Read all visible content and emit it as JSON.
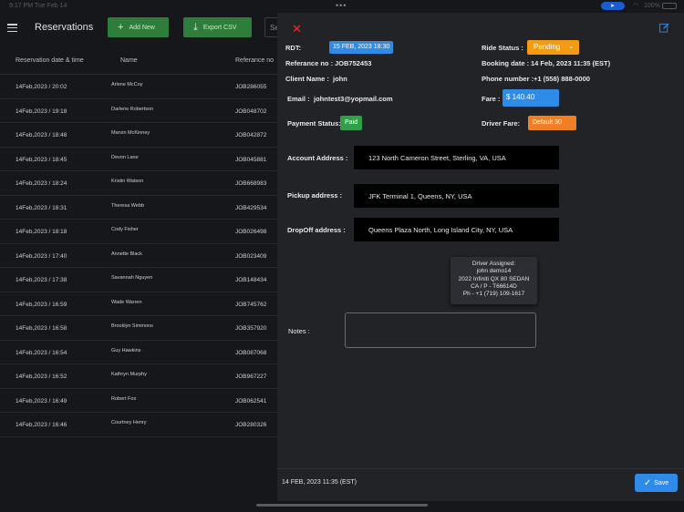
{
  "status_bar": {
    "time": "9:17 PM   Tue Feb 14",
    "battery": "100%"
  },
  "header": {
    "title": "Reservations",
    "add_label": "Add New",
    "export_label": "Export CSV",
    "search_placeholder": "Se"
  },
  "table": {
    "columns": [
      "Reservation date & time",
      "Name",
      "Referance no"
    ],
    "rows": [
      {
        "date": "14Feb,2023 / 20:02",
        "name": "Arlene McCoy",
        "ref": "JOB286055"
      },
      {
        "date": "14Feb,2023 / 19:18",
        "name": "Darlene Robertson",
        "ref": "JOB048702"
      },
      {
        "date": "14Feb,2023 / 18:48",
        "name": "Marvin McKinney",
        "ref": "JOB042872"
      },
      {
        "date": "14Feb,2023 / 18:45",
        "name": "Devon Lane",
        "ref": "JOB045881"
      },
      {
        "date": "14Feb,2023 / 18:24",
        "name": "Kristin Watson",
        "ref": "JOB668983"
      },
      {
        "date": "14Feb,2023 / 18:31",
        "name": "Theresa Webb",
        "ref": "JOB429534"
      },
      {
        "date": "14Feb,2023 / 18:18",
        "name": "Cody Fisher",
        "ref": "JOB026498"
      },
      {
        "date": "14Feb,2023 / 17:40",
        "name": "Annette Black",
        "ref": "JOB023409"
      },
      {
        "date": "14Feb,2023 / 17:38",
        "name": "Savannah Nguyen",
        "ref": "JOB148434"
      },
      {
        "date": "14Feb,2023 / 16:59",
        "name": "Wade Warren",
        "ref": "JOB745762"
      },
      {
        "date": "14Feb,2023 / 16:58",
        "name": "Brooklyn Simmons",
        "ref": "JOB357920"
      },
      {
        "date": "14Feb,2023 / 16:54",
        "name": "Guy Hawkins",
        "ref": "JOB087068"
      },
      {
        "date": "14Feb,2023 / 16:52",
        "name": "Kathryn Murphy",
        "ref": "JOB967227"
      },
      {
        "date": "14Feb,2023 / 16:49",
        "name": "Robert Fox",
        "ref": "JOB062541"
      },
      {
        "date": "14Feb,2023 / 16:46",
        "name": "Courtney Henry",
        "ref": "JOB280326"
      }
    ]
  },
  "detail": {
    "rdt_label": "RDT:",
    "rdt_value": "15 FEB, 2023 18:30",
    "ride_status_label": "Ride Status :",
    "ride_status_value": "Pending",
    "ref_label": "Referance no :",
    "ref_value": "JOB752453",
    "booking_label": "Booking date :",
    "booking_value": "14 Feb, 2023 11:35 (EST)",
    "client_label": "Client Name :",
    "client_value": "john",
    "phone_label": "Phone number :",
    "phone_value": "+1 (558) 888-0000",
    "email_label": "Email :",
    "email_value": "johntest3@yopmail.com",
    "fare_label": "Fare :",
    "fare_value": "$ 140.40",
    "payment_label": "Payment Status:",
    "payment_value": "Paid",
    "driver_fare_label": "Driver Fare:",
    "driver_fare_value": "Default 30",
    "account_addr_label": "Account Address :",
    "account_addr_value": "123 North Cameron Street, Sterling, VA, USA",
    "pickup_label": "Pickup address :",
    "pickup_value": "JFK Terminal 1, Queens, NY, USA",
    "dropoff_label": "DropOff address :",
    "dropoff_value": "Queens Plaza North, Long Island City, NY, USA",
    "driver_lines": [
      "Driver Assigned:",
      "john  demo14",
      "2022 Infiniti QX 80 SEDAN",
      "CA / P -  T66614D",
      "Ph -  +1 (719) 109-1617"
    ],
    "notes_label": "Notes :",
    "notes_value": "",
    "footer_date": "14 FEB, 2023 11:35 (EST)",
    "save_label": "Save"
  },
  "colors": {
    "accent_blue": "#2f8be6",
    "status_orange": "#f39c12",
    "paid_green": "#2ea04a",
    "close_red": "#e0333a"
  }
}
